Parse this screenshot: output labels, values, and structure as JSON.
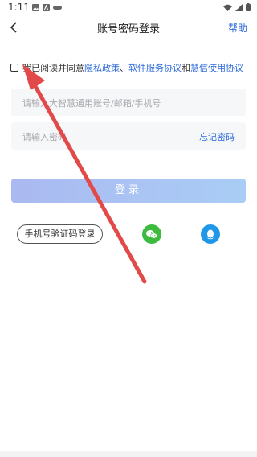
{
  "status_bar": {
    "time": "1:11",
    "left_icons": [
      "image-icon",
      "a-icon",
      "controller-icon"
    ],
    "right_icons": [
      "wifi-icon",
      "signal-icon",
      "battery-icon"
    ]
  },
  "nav": {
    "title": "账号密码登录",
    "help_label": "帮助",
    "back_icon": "chevron-left-icon"
  },
  "agreement": {
    "prefix": "我已阅读并同意 ",
    "link_privacy": "隐私政策",
    "sep1": "、",
    "link_software": "软件服务协议",
    "and_text": " 和 ",
    "link_huixin": "慧信使用协议",
    "checked": false
  },
  "account_input": {
    "placeholder": "请输入大智慧通用账号/邮箱/手机号"
  },
  "password_input": {
    "placeholder": "请输入密码",
    "forgot_label": "忘记密码"
  },
  "login_button": {
    "label": "登录"
  },
  "alt_login": {
    "sms_label": "手机号验证码登录",
    "wechat_icon": "wechat-icon",
    "qq_icon": "qq-icon",
    "wechat_color": "#3dbb3f",
    "qq_color": "#1e97e8"
  },
  "colors": {
    "link": "#2d6bd9",
    "annotation_arrow": "#e24a4a"
  }
}
